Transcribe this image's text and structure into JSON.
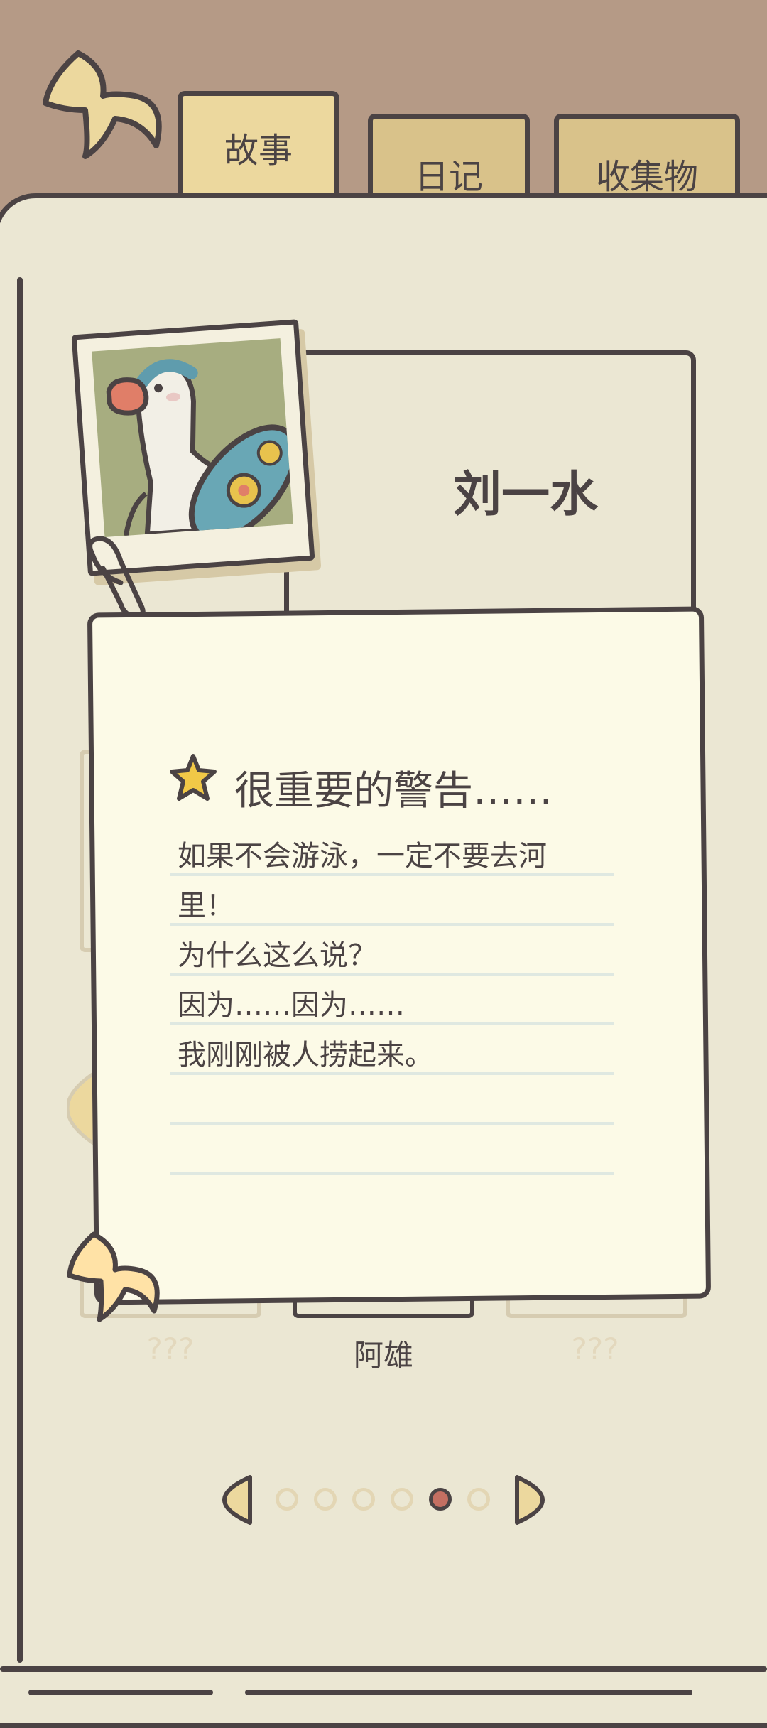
{
  "tabs": {
    "story": "故事",
    "diary": "日记",
    "collection": "收集物"
  },
  "character": {
    "name": "刘一水"
  },
  "note": {
    "title": "很重要的警告……",
    "lines": [
      "如果不会游泳，一定不要去河",
      "里！",
      "为什么这么说？",
      "因为……因为……",
      "我刚刚被人捞起来。"
    ]
  },
  "gallery": {
    "left_label": "???",
    "center_label": "阿雄",
    "right_label": "???"
  },
  "pager": {
    "total": 6,
    "active_index": 4
  },
  "colors": {
    "background": "#b59a86",
    "page": "#ebe7d3",
    "note": "#fcfae7",
    "outline": "#4b4344",
    "tab_active": "#ecd89e",
    "tab_inactive": "#d9c28a",
    "active_dot": "#c46f62"
  }
}
